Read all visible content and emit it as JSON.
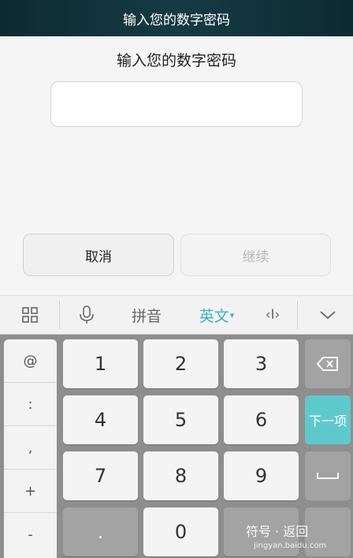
{
  "titlebar": {
    "title": "输入您的数字密码"
  },
  "dialog": {
    "prompt": "输入您的数字密码",
    "cancel_label": "取消",
    "continue_label": "继续"
  },
  "keyboard_toolbar": {
    "pinyin_label": "拼音",
    "english_label": "英文",
    "english_caret": "▾",
    "cursor_label": "‹I›"
  },
  "symbols": [
    "@",
    ":",
    ",",
    "+",
    "-"
  ],
  "keys": {
    "k1": "1",
    "k2": "2",
    "k3": "3",
    "k4": "4",
    "k5": "5",
    "k6": "6",
    "k7": "7",
    "k8": "8",
    "k9": "9",
    "dot": ".",
    "k0": "0"
  },
  "side_keys": {
    "next_label": "下一项"
  },
  "watermark": {
    "main": "符号 · 返回",
    "sub": "jingyan.baidu.com"
  },
  "colors": {
    "accent": "#35b6bf",
    "next_key": "#5ec9cb"
  }
}
